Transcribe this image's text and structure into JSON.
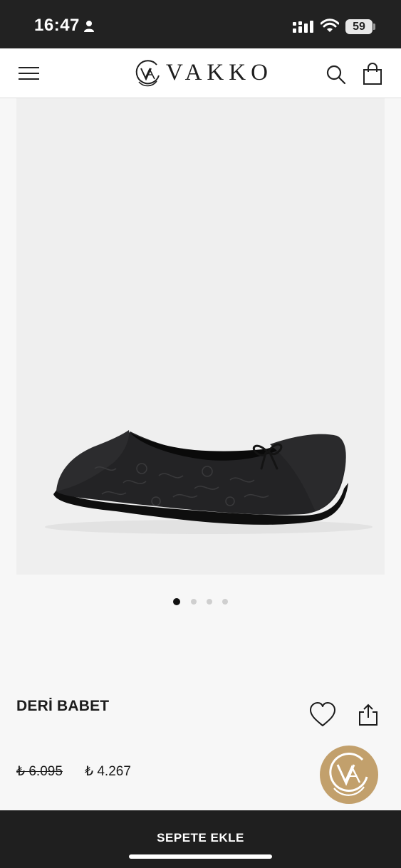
{
  "status_bar": {
    "time": "16:47",
    "battery": "59",
    "icons": [
      "person-icon",
      "signal-icon",
      "wifi-icon",
      "battery-icon"
    ]
  },
  "header": {
    "brand": "VAKKO",
    "icons": [
      "menu-icon",
      "brand-monogram-icon",
      "search-icon",
      "shopping-bag-icon"
    ]
  },
  "product": {
    "title": "DERİ BABET",
    "price_old": "₺ 6.095",
    "price_new": "₺ 4.267",
    "image_count": 4,
    "active_image": 1,
    "image_description_icon": "ballet-flat-shoe-image"
  },
  "actions": {
    "add_to_cart": "SEPETE EKLE",
    "icons": [
      "heart-icon",
      "share-icon"
    ]
  },
  "colors": {
    "status_bar": "#222222",
    "bottom_bar": "#1f1f1f",
    "badge": "#c2a06c",
    "image_background": "#efefef"
  }
}
